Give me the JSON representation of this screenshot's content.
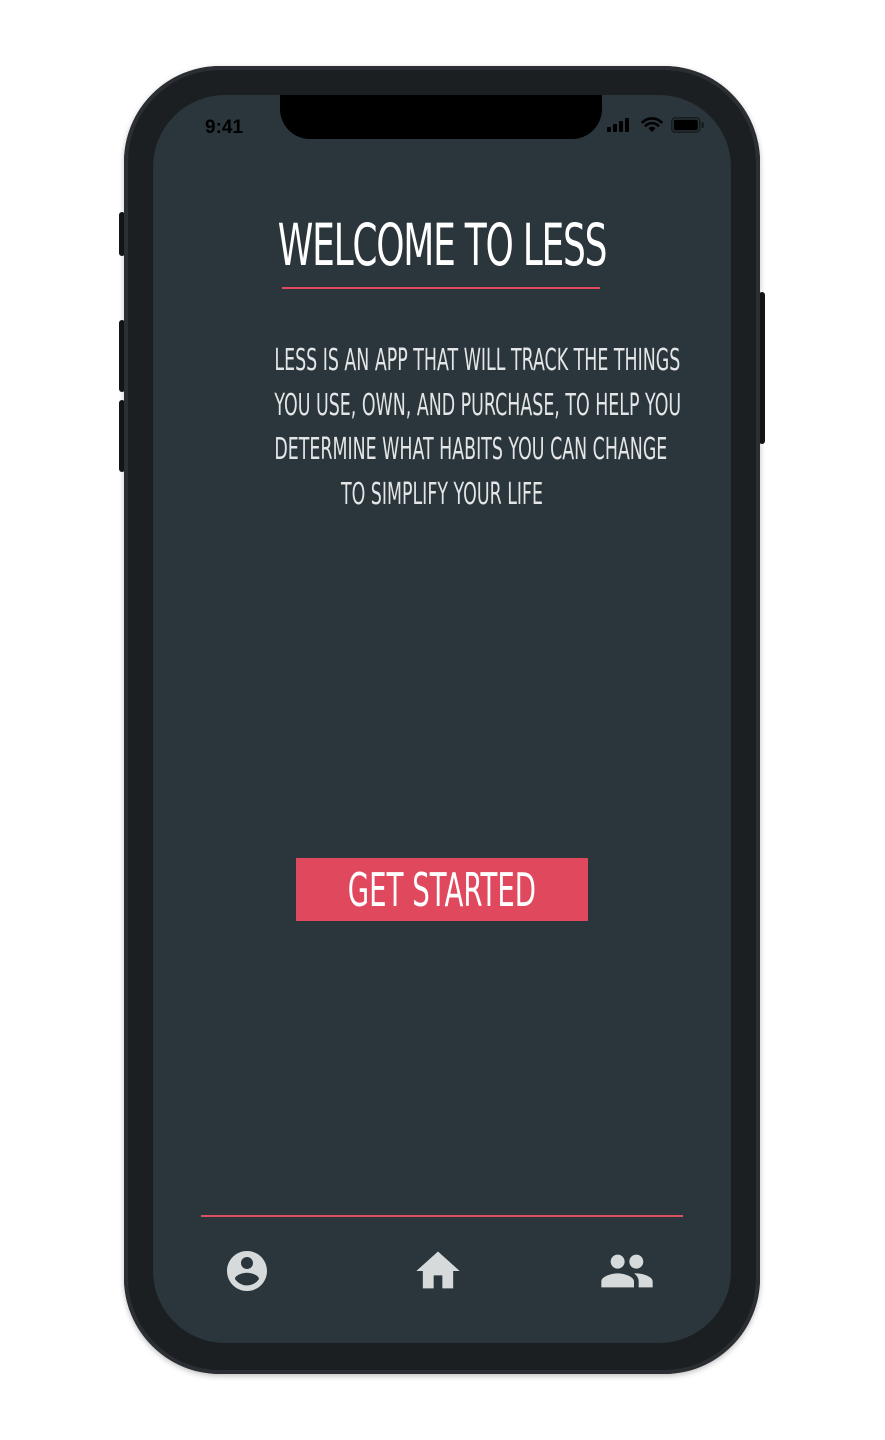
{
  "status_bar": {
    "time": "9:41",
    "icons": [
      "cellular-signal-icon",
      "wifi-icon",
      "battery-icon"
    ]
  },
  "welcome": {
    "title": "WELCOME TO LESS",
    "description_lines": [
      "LESS IS AN APP THAT WILL TRACK THE THINGS",
      "YOU USE, OWN, AND PURCHASE, TO HELP YOU",
      "DETERMINE WHAT HABITS YOU CAN CHANGE",
      "TO SIMPLIFY YOUR LIFE"
    ]
  },
  "cta": {
    "label": "GET STARTED"
  },
  "tab_bar": {
    "items": [
      {
        "icon": "account-circle-icon"
      },
      {
        "icon": "home-icon"
      },
      {
        "icon": "people-icon"
      }
    ]
  },
  "colors": {
    "screen_background": "#2a363b",
    "accent": "#e0485d",
    "text": "#ffffff",
    "icon": "#d7dadb"
  }
}
